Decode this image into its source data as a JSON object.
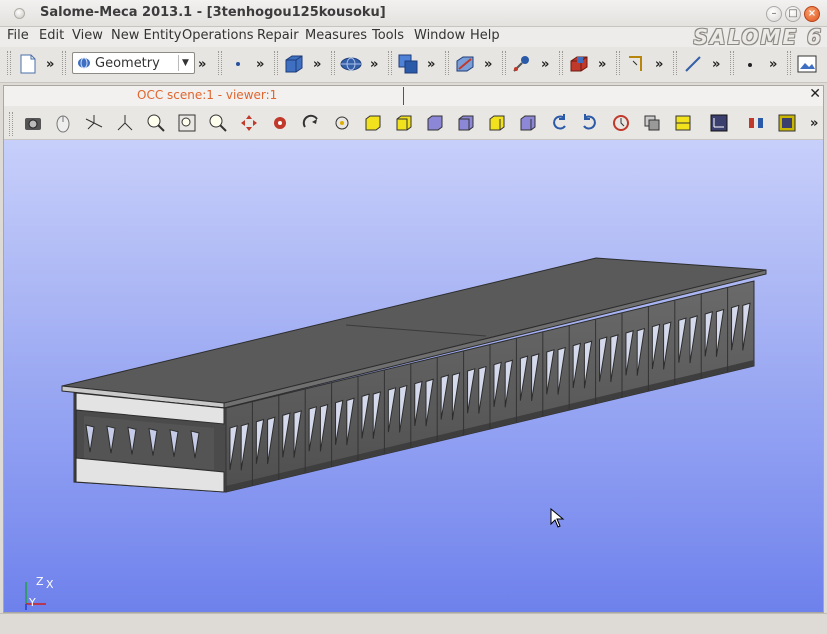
{
  "window": {
    "title": "Salome-Meca 2013.1 - [3tenhogou125kousoku]",
    "logo_text": "SALOME 6"
  },
  "menu": [
    "File",
    "Edit",
    "View",
    "New Entity",
    "Operations",
    "Repair",
    "Measures",
    "Tools",
    "Window",
    "Help"
  ],
  "toolbar": {
    "module_combo_value": "Geometry",
    "more_glyph": "»"
  },
  "viewer": {
    "tab_title": "OCC scene:1 - viewer:1",
    "close_glyph": "✕"
  },
  "axes": {
    "x": "X",
    "y": "Y",
    "z": "Z"
  },
  "colors": {
    "accent_tab": "#e0652e",
    "scene_top": "#c7cffa",
    "scene_bottom": "#6e81ec",
    "model_fill": "#5f5f5f"
  }
}
